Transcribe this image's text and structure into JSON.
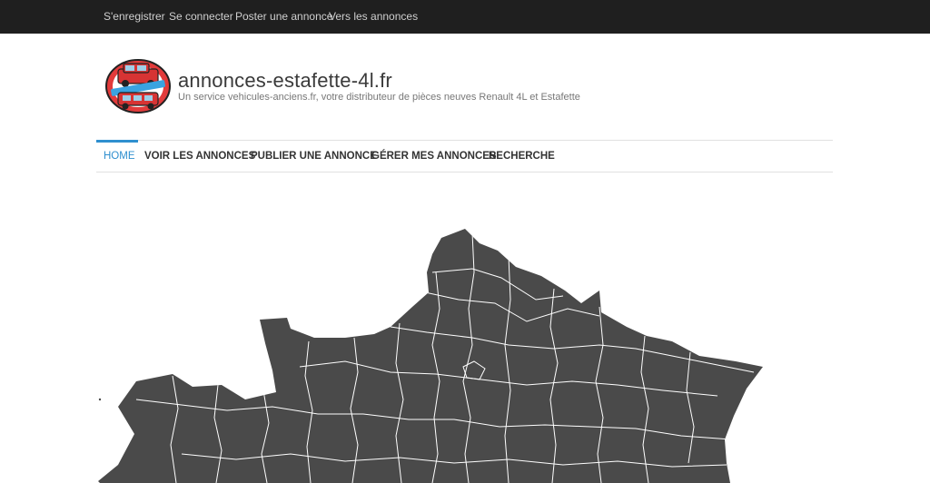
{
  "topbar": {
    "links": [
      {
        "label": "S'enregistrer"
      },
      {
        "label": "Se connecter"
      },
      {
        "label": "Poster une annonce"
      },
      {
        "label": "Vers les annonces"
      }
    ]
  },
  "header": {
    "title": "annonces-estafette-4l.fr",
    "tagline": "Un service vehicules-anciens.fr, votre distributeur de pièces neuves Renault 4L et Estafette",
    "logo_icon": "car-logo-icon"
  },
  "nav": {
    "items": [
      {
        "label": "Home",
        "active": true
      },
      {
        "label": "Voir les annonces"
      },
      {
        "label": "Publier une annonce"
      },
      {
        "label": "Gérer mes annonces"
      },
      {
        "label": "Recherche"
      }
    ]
  },
  "map": {
    "fill_color": "#4a4a4a",
    "border_color": "#ffffff",
    "icon": "france-regions-map"
  },
  "colors": {
    "topbar_bg": "#1f1f1f",
    "accent": "#2f8fcf"
  }
}
